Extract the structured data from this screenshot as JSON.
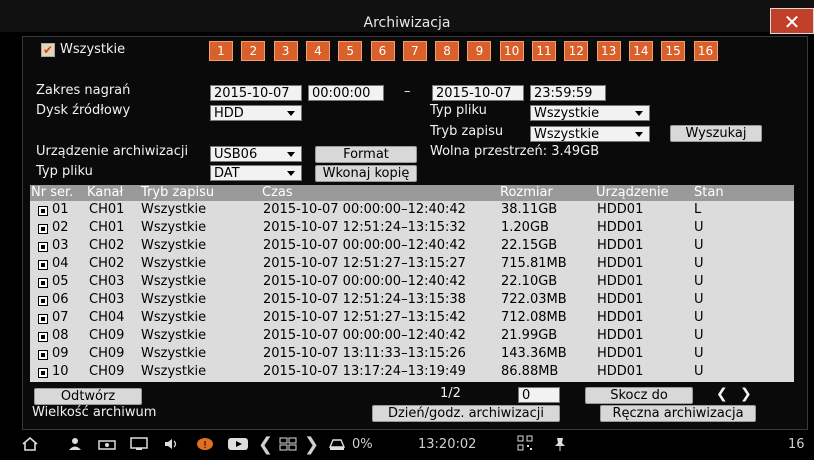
{
  "window": {
    "title": "Archiwizacja",
    "close_label": "✕"
  },
  "filter": {
    "all_label": "Wszystkie",
    "channels": [
      "1",
      "2",
      "3",
      "4",
      "5",
      "6",
      "7",
      "8",
      "9",
      "10",
      "11",
      "12",
      "13",
      "14",
      "15",
      "16"
    ]
  },
  "form": {
    "range_label": "Zakres nagrań",
    "start_date": "2015-10-07",
    "start_time": "00:00:00",
    "dash": "–",
    "end_date": "2015-10-07",
    "end_time": "23:59:59",
    "source_disk_label": "Dysk źródłowy",
    "source_disk_value": "HDD",
    "file_type_label": "Typ pliku",
    "file_type_value": "Wszystkie",
    "record_mode_label": "Tryb zapisu",
    "record_mode_value": "Wszystkie",
    "search_button": "Wyszukaj",
    "device_label": "Urządzenie archiwizacji",
    "device_value": "USB06",
    "format_button": "Format",
    "free_space_text": "Wolna przestrzeń: 3.49GB",
    "output_type_label": "Typ pliku",
    "output_type_value": "DAT",
    "copy_button": "Wkonaj kopię"
  },
  "table": {
    "headers": [
      "Nr ser.",
      "Kanał",
      "Tryb zapisu",
      "Czas",
      "Rozmiar",
      "Urządzenie",
      "Stan"
    ],
    "rows": [
      {
        "nr": "01",
        "ch": "CH01",
        "mode": "Wszystkie",
        "time": "2015-10-07 00:00:00–12:40:42",
        "size": "38.11GB",
        "dev": "HDD01",
        "state": "L"
      },
      {
        "nr": "02",
        "ch": "CH01",
        "mode": "Wszystkie",
        "time": "2015-10-07 12:51:24–13:15:32",
        "size": "1.20GB",
        "dev": "HDD01",
        "state": "U"
      },
      {
        "nr": "03",
        "ch": "CH02",
        "mode": "Wszystkie",
        "time": "2015-10-07 00:00:00–12:40:42",
        "size": "22.15GB",
        "dev": "HDD01",
        "state": "U"
      },
      {
        "nr": "04",
        "ch": "CH02",
        "mode": "Wszystkie",
        "time": "2015-10-07 12:51:27–13:15:27",
        "size": "715.81MB",
        "dev": "HDD01",
        "state": "U"
      },
      {
        "nr": "05",
        "ch": "CH03",
        "mode": "Wszystkie",
        "time": "2015-10-07 00:00:00–12:40:42",
        "size": "22.10GB",
        "dev": "HDD01",
        "state": "U"
      },
      {
        "nr": "06",
        "ch": "CH03",
        "mode": "Wszystkie",
        "time": "2015-10-07 12:51:24–13:15:38",
        "size": "722.03MB",
        "dev": "HDD01",
        "state": "U"
      },
      {
        "nr": "07",
        "ch": "CH04",
        "mode": "Wszystkie",
        "time": "2015-10-07 12:51:27–13:15:42",
        "size": "712.08MB",
        "dev": "HDD01",
        "state": "U"
      },
      {
        "nr": "08",
        "ch": "CH09",
        "mode": "Wszystkie",
        "time": "2015-10-07 00:00:00–12:40:42",
        "size": "21.99GB",
        "dev": "HDD01",
        "state": "U"
      },
      {
        "nr": "09",
        "ch": "CH09",
        "mode": "Wszystkie",
        "time": "2015-10-07 13:11:33–13:15:26",
        "size": "143.36MB",
        "dev": "HDD01",
        "state": "U"
      },
      {
        "nr": "10",
        "ch": "CH09",
        "mode": "Wszystkie",
        "time": "2015-10-07 13:17:24–13:19:49",
        "size": "86.88MB",
        "dev": "HDD01",
        "state": "U"
      }
    ]
  },
  "pager": {
    "play_button": "Odtwórz",
    "page_text": "1/2",
    "page_input": "0",
    "goto_button": "Skocz do",
    "prev": "❮",
    "next": "❯",
    "archive_size_label": "Wielkość archiwum",
    "date_archive_button": "Dzień/godz. archiwizacji",
    "manual_archive_button": "Ręczna archiwizacja"
  },
  "taskbar": {
    "progress": "0%",
    "clock": "13:20:02",
    "channel_count": "16"
  },
  "colors": {
    "accent": "#d9602a",
    "close": "#c0402a",
    "table_body": "#dcdcdc",
    "table_head": "#9a9a9a"
  }
}
